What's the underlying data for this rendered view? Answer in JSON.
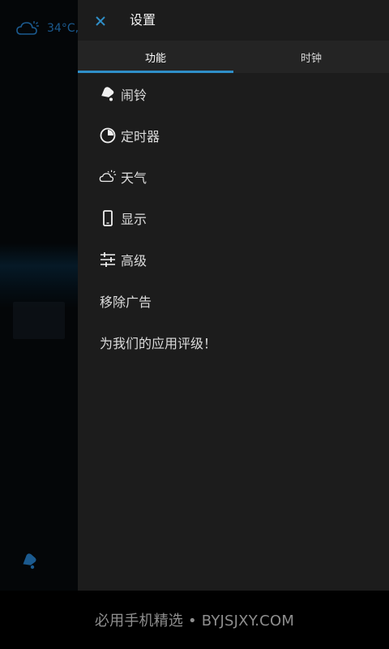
{
  "background": {
    "weather": {
      "icon": "cloud-sun-icon",
      "temperature": "34°C,"
    },
    "bell_icon": "bell-icon",
    "accent_color": "#1b5a8f"
  },
  "drawer": {
    "close_icon": "close-icon",
    "title": "设置",
    "tabs": [
      {
        "label": "功能",
        "active": true
      },
      {
        "label": "时钟",
        "active": false
      }
    ],
    "items": [
      {
        "label": "闹铃",
        "icon": "alarm-bell-icon"
      },
      {
        "label": "定时器",
        "icon": "timer-icon"
      },
      {
        "label": "天气",
        "icon": "weather-icon"
      },
      {
        "label": "显示",
        "icon": "phone-display-icon"
      },
      {
        "label": "高级",
        "icon": "sliders-icon"
      },
      {
        "label": "移除广告",
        "icon": null
      },
      {
        "label": "为我们的应用评级！",
        "icon": null
      }
    ],
    "accent_color": "#2f8fc8"
  },
  "footer": {
    "watermark": "必用手机精选 • BYJSJXY.COM"
  }
}
